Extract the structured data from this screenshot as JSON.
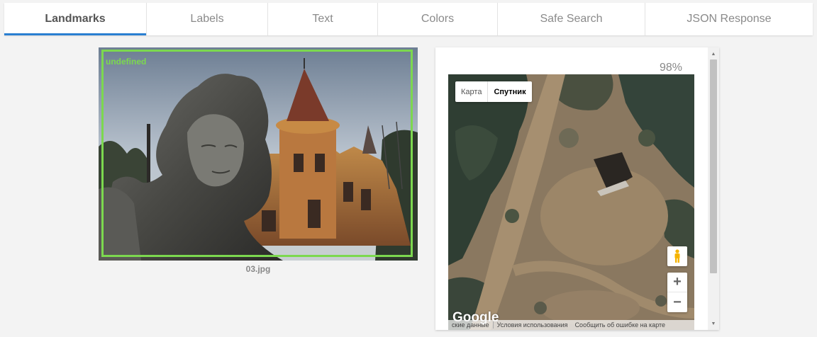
{
  "tabs": [
    {
      "label": "Landmarks",
      "active": true
    },
    {
      "label": "Labels",
      "active": false
    },
    {
      "label": "Text",
      "active": false
    },
    {
      "label": "Colors",
      "active": false
    },
    {
      "label": "Safe Search",
      "active": false
    },
    {
      "label": "JSON Response",
      "active": false
    }
  ],
  "image": {
    "filename": "03.jpg",
    "landmark_label": "undefined",
    "box_color": "#7cd84f"
  },
  "result": {
    "score": "98%"
  },
  "map": {
    "type_buttons": [
      "Карта",
      "Спутник"
    ],
    "active_type": "Спутник",
    "zoom_in": "+",
    "zoom_out": "−",
    "logo": "Google",
    "attribution": [
      "ские данные",
      "Условия использования",
      "Сообщить об ошибке на карте"
    ]
  },
  "scrollbar": {
    "up_arrow": "▲",
    "down_arrow": "▼"
  },
  "colors": {
    "accent": "#2a7fd1",
    "bbox": "#7cd84f"
  }
}
